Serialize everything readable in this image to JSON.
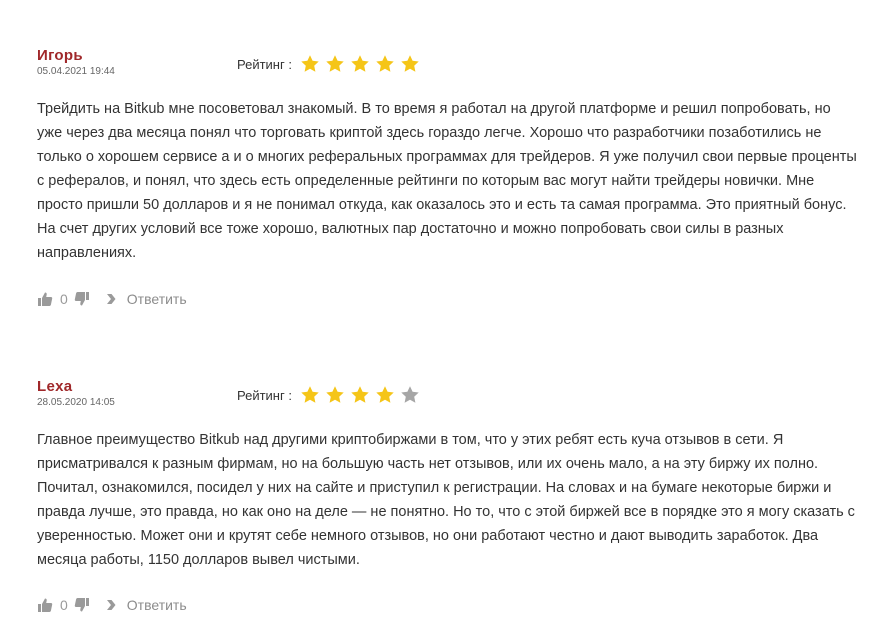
{
  "rating_label": "Рейтинг :",
  "reply_label": "Ответить",
  "colors": {
    "author": "#a0282a",
    "star_filled": "#f5c518",
    "star_empty": "#a6a6a6",
    "icon": "#9a9a9a"
  },
  "reviews": [
    {
      "author": "Игорь",
      "date": "05.04.2021 19:44",
      "rating": 5,
      "rating_max": 5,
      "text": "Трейдить на Bitkub мне посоветовал знакомый. В то время я работал на другой платформе и решил попробовать, но уже через два месяца понял что торговать криптой здесь гораздо легче. Хорошо что разработчики позаботились не только о хорошем сервисе а и о многих реферальных программах для трейдеров. Я уже получил свои первые проценты с рефералов, и понял, что здесь есть определенные рейтинги по которым вас могут найти трейдеры новички. Мне просто пришли 50 долларов и я не понимал откуда, как оказалось это и есть та самая программа. Это приятный бонус. На счет других условий все тоже хорошо, валютных пар достаточно и можно попробовать свои силы в разных направлениях.",
      "likes": "0"
    },
    {
      "author": "Lexa",
      "date": "28.05.2020 14:05",
      "rating": 4,
      "rating_max": 5,
      "text": "Главное преимущество Bitkub над другими криптобиржами в том, что у этих ребят есть куча отзывов в сети. Я присматривался к разным фирмам, но на большую часть нет отзывов, или их очень мало, а на эту биржу их полно. Почитал, ознакомился, посидел у них на сайте и приступил к регистрации. На словах и на бумаге некоторые биржи и правда лучше, это правда, но как оно на деле — не понятно. Но то, что с этой биржей все в порядке это я могу сказать с уверенностью. Может они и крутят себе немного отзывов, но они работают честно и дают выводить заработок. Два месяца работы, 1150 долларов вывел чистыми.",
      "likes": "0"
    }
  ]
}
